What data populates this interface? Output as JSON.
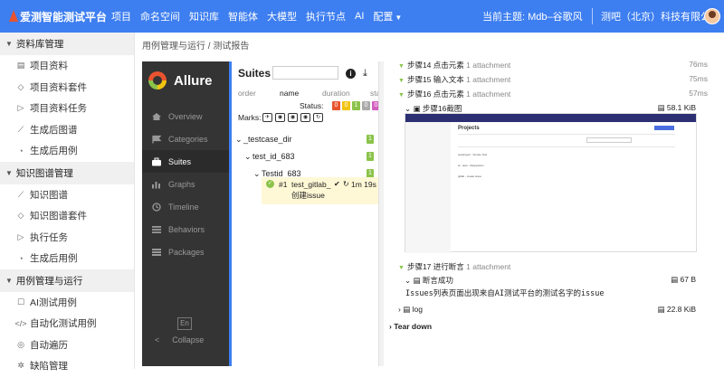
{
  "topbar": {
    "brand": "爱测智能测试平台",
    "nav": [
      "项目",
      "命名空间",
      "知识库",
      "智能体",
      "大模型",
      "执行节点",
      "AI",
      "配置"
    ],
    "theme": "当前主题: Mdb–谷歌风",
    "company": "测吧（北京）科技有限公司",
    "colors": {
      "bar": "#3d7ef0",
      "logo": "#e8542e"
    }
  },
  "sidebar": {
    "groups": [
      {
        "label": "资料库管理",
        "items": [
          "项目资料",
          "项目资料套件",
          "项目资料任务",
          "生成后图谱",
          "生成后用例"
        ]
      },
      {
        "label": "知识图谱管理",
        "items": [
          "知识图谱",
          "知识图谱套件",
          "执行任务",
          "生成后用例"
        ]
      },
      {
        "label": "用例管理与运行",
        "items": [
          "AI测试用例",
          "自动化测试用例",
          "自动遍历",
          "缺陷管理"
        ]
      }
    ]
  },
  "breadcrumb": "用例管理与运行 / 测试报告",
  "allure": {
    "brand": "Allure",
    "nav": [
      "Overview",
      "Categories",
      "Suites",
      "Graphs",
      "Timeline",
      "Behaviors",
      "Packages"
    ],
    "active": "Suites",
    "lang": "En",
    "collapse": "Collapse"
  },
  "suites": {
    "title": "Suites",
    "columns": [
      "order",
      "name",
      "duration",
      "sta"
    ],
    "status_label": "Status:",
    "status_counts": [
      "0",
      "0",
      "1",
      "0",
      "0"
    ],
    "marks_label": "Marks:",
    "tree": [
      {
        "label": "_testcase_dir",
        "count": "1"
      },
      {
        "label": "test_id_683",
        "count": "1"
      },
      {
        "label": "Testid_683",
        "count": "1"
      }
    ],
    "case": {
      "num": "#1",
      "name_line1": "test_gitlab_",
      "name_line2": "创建issue",
      "duration": "1m 19s"
    }
  },
  "detail": {
    "steps": [
      {
        "label": "步骤14 点击元素",
        "attach": "1 attachment",
        "dur": "76ms"
      },
      {
        "label": "步骤15 输入文本",
        "attach": "1 attachment",
        "dur": "75ms"
      },
      {
        "label": "步骤16 点击元素",
        "attach": "1 attachment",
        "dur": "57ms"
      }
    ],
    "shot_attach": {
      "name": "步骤16截图",
      "size": "58.1 KiB"
    },
    "screenshot": {
      "heading": "Projects",
      "rows": [
        "testproject - Smoke Test",
        "ai - auto - Regression",
        "gitlab - create issue"
      ]
    },
    "step17": {
      "label": "步骤17 进行断言",
      "attach": "1 attachment"
    },
    "assert_attach": {
      "name": "断言成功",
      "size": "67 B"
    },
    "issue_text": "Issues列表页面出现来自AI测试平台的测试名字的issue",
    "log_attach": {
      "name": "log",
      "size": "22.8 KiB"
    },
    "teardown": "Tear down"
  }
}
